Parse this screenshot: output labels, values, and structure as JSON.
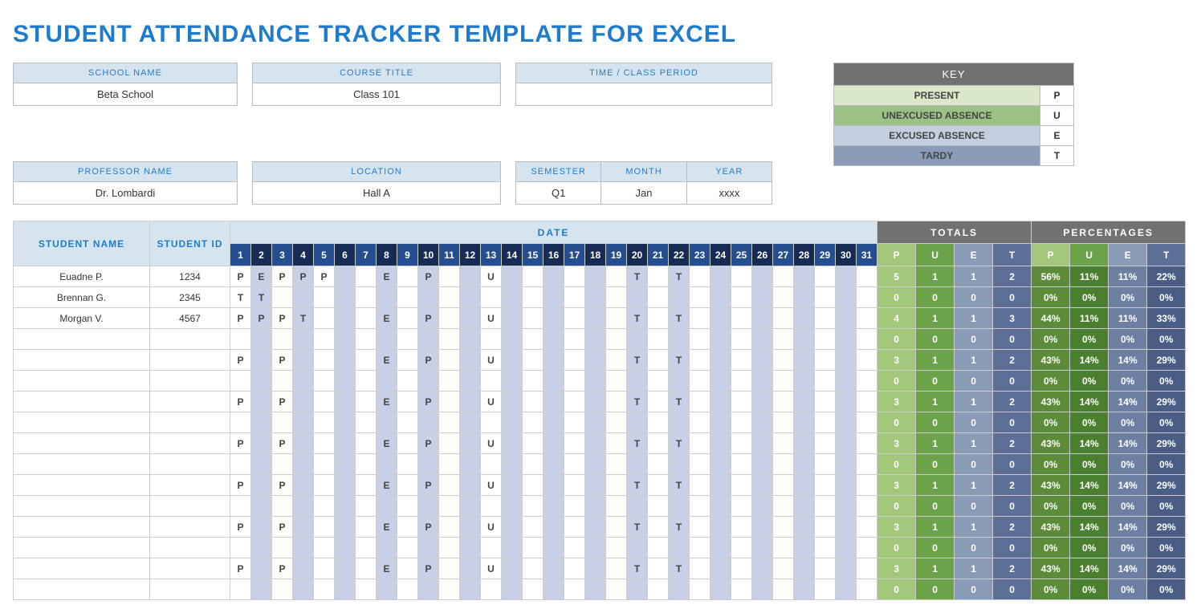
{
  "title": "STUDENT ATTENDANCE TRACKER TEMPLATE FOR EXCEL",
  "info": {
    "school_label": "SCHOOL NAME",
    "school_value": "Beta School",
    "course_label": "COURSE TITLE",
    "course_value": "Class 101",
    "period_label": "TIME / CLASS PERIOD",
    "period_value": "",
    "prof_label": "PROFESSOR NAME",
    "prof_value": "Dr. Lombardi",
    "loc_label": "LOCATION",
    "loc_value": "Hall A",
    "sem_label": "SEMESTER",
    "sem_value": "Q1",
    "month_label": "MONTH",
    "month_value": "Jan",
    "year_label": "YEAR",
    "year_value": "xxxx"
  },
  "key": {
    "title": "KEY",
    "present_label": "PRESENT",
    "present_code": "P",
    "unex_label": "UNEXCUSED ABSENCE",
    "unex_code": "U",
    "exc_label": "EXCUSED ABSENCE",
    "exc_code": "E",
    "tardy_label": "TARDY",
    "tardy_code": "T"
  },
  "table": {
    "student_name_hdr": "STUDENT NAME",
    "student_id_hdr": "STUDENT ID",
    "date_hdr": "DATE",
    "totals_hdr": "TOTALS",
    "perc_hdr": "PERCENTAGES",
    "tp_labels": {
      "p": "P",
      "u": "U",
      "e": "E",
      "t": "T"
    },
    "days": [
      "1",
      "2",
      "3",
      "4",
      "5",
      "6",
      "7",
      "8",
      "9",
      "10",
      "11",
      "12",
      "13",
      "14",
      "15",
      "16",
      "17",
      "18",
      "19",
      "20",
      "21",
      "22",
      "23",
      "24",
      "25",
      "26",
      "27",
      "28",
      "29",
      "30",
      "31"
    ]
  },
  "rows": [
    {
      "name": "Euadne P.",
      "id": "1234",
      "d": [
        "P",
        "E",
        "P",
        "P",
        "P",
        "",
        "",
        "E",
        "",
        "P",
        "",
        "",
        "U",
        "",
        "",
        "",
        "",
        "",
        "",
        "T",
        "",
        "T",
        "",
        "",
        "",
        "",
        "",
        "",
        "",
        "",
        ""
      ],
      "t": {
        "p": "5",
        "u": "1",
        "e": "1",
        "t": "2"
      },
      "pc": {
        "p": "56%",
        "u": "11%",
        "e": "11%",
        "t": "22%"
      }
    },
    {
      "name": "Brennan G.",
      "id": "2345",
      "d": [
        "T",
        "T",
        "",
        "",
        "",
        "",
        "",
        "",
        "",
        "",
        "",
        "",
        "",
        "",
        "",
        "",
        "",
        "",
        "",
        "",
        "",
        "",
        "",
        "",
        "",
        "",
        "",
        "",
        "",
        "",
        ""
      ],
      "t": {
        "p": "0",
        "u": "0",
        "e": "0",
        "t": "0"
      },
      "pc": {
        "p": "0%",
        "u": "0%",
        "e": "0%",
        "t": "0%"
      }
    },
    {
      "name": "Morgan V.",
      "id": "4567",
      "d": [
        "P",
        "P",
        "P",
        "T",
        "",
        "",
        "",
        "E",
        "",
        "P",
        "",
        "",
        "U",
        "",
        "",
        "",
        "",
        "",
        "",
        "T",
        "",
        "T",
        "",
        "",
        "",
        "",
        "",
        "",
        "",
        "",
        ""
      ],
      "t": {
        "p": "4",
        "u": "1",
        "e": "1",
        "t": "3"
      },
      "pc": {
        "p": "44%",
        "u": "11%",
        "e": "11%",
        "t": "33%"
      }
    },
    {
      "name": "",
      "id": "",
      "d": [
        "",
        "",
        "",
        "",
        "",
        "",
        "",
        "",
        "",
        "",
        "",
        "",
        "",
        "",
        "",
        "",
        "",
        "",
        "",
        "",
        "",
        "",
        "",
        "",
        "",
        "",
        "",
        "",
        "",
        "",
        ""
      ],
      "t": {
        "p": "0",
        "u": "0",
        "e": "0",
        "t": "0"
      },
      "pc": {
        "p": "0%",
        "u": "0%",
        "e": "0%",
        "t": "0%"
      }
    },
    {
      "name": "",
      "id": "",
      "d": [
        "P",
        "",
        "P",
        "",
        "",
        "",
        "",
        "E",
        "",
        "P",
        "",
        "",
        "U",
        "",
        "",
        "",
        "",
        "",
        "",
        "T",
        "",
        "T",
        "",
        "",
        "",
        "",
        "",
        "",
        "",
        "",
        ""
      ],
      "t": {
        "p": "3",
        "u": "1",
        "e": "1",
        "t": "2"
      },
      "pc": {
        "p": "43%",
        "u": "14%",
        "e": "14%",
        "t": "29%"
      }
    },
    {
      "name": "",
      "id": "",
      "d": [
        "",
        "",
        "",
        "",
        "",
        "",
        "",
        "",
        "",
        "",
        "",
        "",
        "",
        "",
        "",
        "",
        "",
        "",
        "",
        "",
        "",
        "",
        "",
        "",
        "",
        "",
        "",
        "",
        "",
        "",
        ""
      ],
      "t": {
        "p": "0",
        "u": "0",
        "e": "0",
        "t": "0"
      },
      "pc": {
        "p": "0%",
        "u": "0%",
        "e": "0%",
        "t": "0%"
      }
    },
    {
      "name": "",
      "id": "",
      "d": [
        "P",
        "",
        "P",
        "",
        "",
        "",
        "",
        "E",
        "",
        "P",
        "",
        "",
        "U",
        "",
        "",
        "",
        "",
        "",
        "",
        "T",
        "",
        "T",
        "",
        "",
        "",
        "",
        "",
        "",
        "",
        "",
        ""
      ],
      "t": {
        "p": "3",
        "u": "1",
        "e": "1",
        "t": "2"
      },
      "pc": {
        "p": "43%",
        "u": "14%",
        "e": "14%",
        "t": "29%"
      }
    },
    {
      "name": "",
      "id": "",
      "d": [
        "",
        "",
        "",
        "",
        "",
        "",
        "",
        "",
        "",
        "",
        "",
        "",
        "",
        "",
        "",
        "",
        "",
        "",
        "",
        "",
        "",
        "",
        "",
        "",
        "",
        "",
        "",
        "",
        "",
        "",
        ""
      ],
      "t": {
        "p": "0",
        "u": "0",
        "e": "0",
        "t": "0"
      },
      "pc": {
        "p": "0%",
        "u": "0%",
        "e": "0%",
        "t": "0%"
      }
    },
    {
      "name": "",
      "id": "",
      "d": [
        "P",
        "",
        "P",
        "",
        "",
        "",
        "",
        "E",
        "",
        "P",
        "",
        "",
        "U",
        "",
        "",
        "",
        "",
        "",
        "",
        "T",
        "",
        "T",
        "",
        "",
        "",
        "",
        "",
        "",
        "",
        "",
        ""
      ],
      "t": {
        "p": "3",
        "u": "1",
        "e": "1",
        "t": "2"
      },
      "pc": {
        "p": "43%",
        "u": "14%",
        "e": "14%",
        "t": "29%"
      }
    },
    {
      "name": "",
      "id": "",
      "d": [
        "",
        "",
        "",
        "",
        "",
        "",
        "",
        "",
        "",
        "",
        "",
        "",
        "",
        "",
        "",
        "",
        "",
        "",
        "",
        "",
        "",
        "",
        "",
        "",
        "",
        "",
        "",
        "",
        "",
        "",
        ""
      ],
      "t": {
        "p": "0",
        "u": "0",
        "e": "0",
        "t": "0"
      },
      "pc": {
        "p": "0%",
        "u": "0%",
        "e": "0%",
        "t": "0%"
      }
    },
    {
      "name": "",
      "id": "",
      "d": [
        "P",
        "",
        "P",
        "",
        "",
        "",
        "",
        "E",
        "",
        "P",
        "",
        "",
        "U",
        "",
        "",
        "",
        "",
        "",
        "",
        "T",
        "",
        "T",
        "",
        "",
        "",
        "",
        "",
        "",
        "",
        "",
        ""
      ],
      "t": {
        "p": "3",
        "u": "1",
        "e": "1",
        "t": "2"
      },
      "pc": {
        "p": "43%",
        "u": "14%",
        "e": "14%",
        "t": "29%"
      }
    },
    {
      "name": "",
      "id": "",
      "d": [
        "",
        "",
        "",
        "",
        "",
        "",
        "",
        "",
        "",
        "",
        "",
        "",
        "",
        "",
        "",
        "",
        "",
        "",
        "",
        "",
        "",
        "",
        "",
        "",
        "",
        "",
        "",
        "",
        "",
        "",
        ""
      ],
      "t": {
        "p": "0",
        "u": "0",
        "e": "0",
        "t": "0"
      },
      "pc": {
        "p": "0%",
        "u": "0%",
        "e": "0%",
        "t": "0%"
      }
    },
    {
      "name": "",
      "id": "",
      "d": [
        "P",
        "",
        "P",
        "",
        "",
        "",
        "",
        "E",
        "",
        "P",
        "",
        "",
        "U",
        "",
        "",
        "",
        "",
        "",
        "",
        "T",
        "",
        "T",
        "",
        "",
        "",
        "",
        "",
        "",
        "",
        "",
        ""
      ],
      "t": {
        "p": "3",
        "u": "1",
        "e": "1",
        "t": "2"
      },
      "pc": {
        "p": "43%",
        "u": "14%",
        "e": "14%",
        "t": "29%"
      }
    },
    {
      "name": "",
      "id": "",
      "d": [
        "",
        "",
        "",
        "",
        "",
        "",
        "",
        "",
        "",
        "",
        "",
        "",
        "",
        "",
        "",
        "",
        "",
        "",
        "",
        "",
        "",
        "",
        "",
        "",
        "",
        "",
        "",
        "",
        "",
        "",
        ""
      ],
      "t": {
        "p": "0",
        "u": "0",
        "e": "0",
        "t": "0"
      },
      "pc": {
        "p": "0%",
        "u": "0%",
        "e": "0%",
        "t": "0%"
      }
    },
    {
      "name": "",
      "id": "",
      "d": [
        "P",
        "",
        "P",
        "",
        "",
        "",
        "",
        "E",
        "",
        "P",
        "",
        "",
        "U",
        "",
        "",
        "",
        "",
        "",
        "",
        "T",
        "",
        "T",
        "",
        "",
        "",
        "",
        "",
        "",
        "",
        "",
        ""
      ],
      "t": {
        "p": "3",
        "u": "1",
        "e": "1",
        "t": "2"
      },
      "pc": {
        "p": "43%",
        "u": "14%",
        "e": "14%",
        "t": "29%"
      }
    },
    {
      "name": "",
      "id": "",
      "d": [
        "",
        "",
        "",
        "",
        "",
        "",
        "",
        "",
        "",
        "",
        "",
        "",
        "",
        "",
        "",
        "",
        "",
        "",
        "",
        "",
        "",
        "",
        "",
        "",
        "",
        "",
        "",
        "",
        "",
        "",
        ""
      ],
      "t": {
        "p": "0",
        "u": "0",
        "e": "0",
        "t": "0"
      },
      "pc": {
        "p": "0%",
        "u": "0%",
        "e": "0%",
        "t": "0%"
      }
    }
  ]
}
